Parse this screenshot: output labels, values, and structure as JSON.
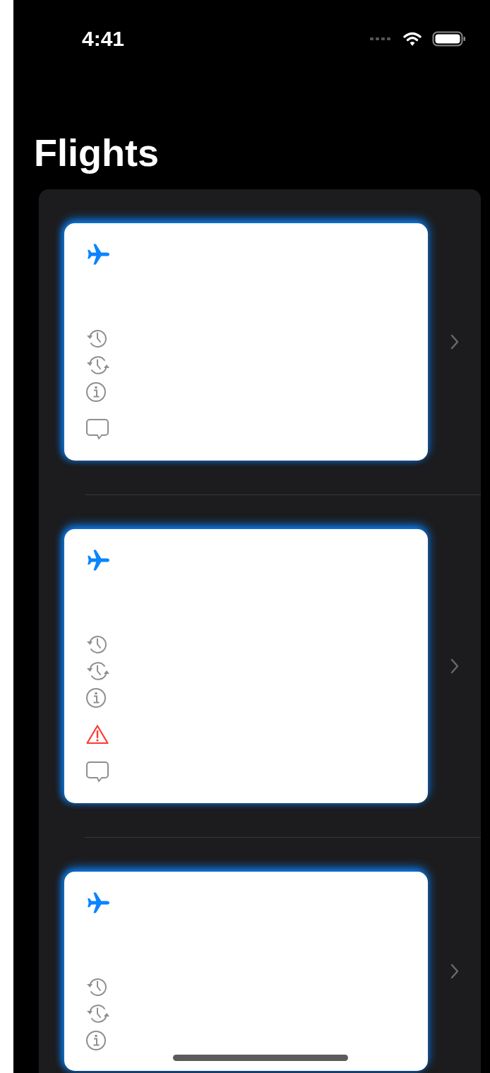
{
  "status_bar": {
    "time": "4:41"
  },
  "title": "Flights",
  "flights": [
    {
      "rows": [
        {
          "kind": "plane"
        },
        {
          "kind": "history"
        },
        {
          "kind": "sync"
        },
        {
          "kind": "info"
        },
        {
          "kind": "comment"
        }
      ]
    },
    {
      "rows": [
        {
          "kind": "plane"
        },
        {
          "kind": "history"
        },
        {
          "kind": "sync"
        },
        {
          "kind": "info"
        },
        {
          "kind": "warning"
        },
        {
          "kind": "comment"
        }
      ]
    },
    {
      "rows": [
        {
          "kind": "plane"
        },
        {
          "kind": "history"
        },
        {
          "kind": "sync"
        },
        {
          "kind": "info"
        }
      ]
    }
  ]
}
